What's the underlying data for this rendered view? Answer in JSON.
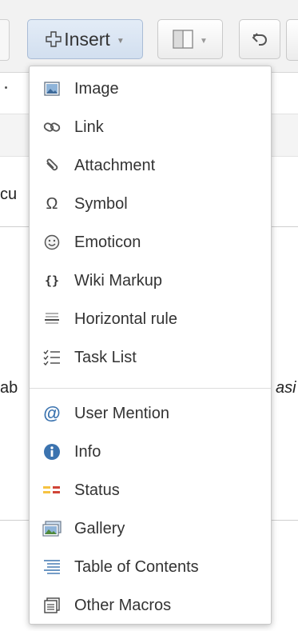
{
  "toolbar": {
    "insert_label": "Insert",
    "insert_icon": "plus-icon",
    "layout_icon": "page-layout-icon",
    "undo_icon": "undo-icon"
  },
  "background_text": {
    "fragment_1": "cu",
    "fragment_2": "ab",
    "fragment_3": "asi"
  },
  "menu": {
    "items": [
      {
        "label": "Image",
        "icon": "image-icon"
      },
      {
        "label": "Link",
        "icon": "link-icon"
      },
      {
        "label": "Attachment",
        "icon": "paperclip-icon"
      },
      {
        "label": "Symbol",
        "icon": "omega-icon"
      },
      {
        "label": "Emoticon",
        "icon": "smiley-icon"
      },
      {
        "label": "Wiki Markup",
        "icon": "braces-icon"
      },
      {
        "label": "Horizontal rule",
        "icon": "horizontal-rule-icon"
      },
      {
        "label": "Task List",
        "icon": "task-list-icon"
      },
      {
        "label": "User Mention",
        "icon": "at-icon"
      },
      {
        "label": "Info",
        "icon": "info-icon"
      },
      {
        "label": "Status",
        "icon": "status-icon"
      },
      {
        "label": "Gallery",
        "icon": "gallery-icon"
      },
      {
        "label": "Table of Contents",
        "icon": "table-of-contents-icon"
      },
      {
        "label": "Other Macros",
        "icon": "macros-icon"
      }
    ]
  },
  "colors": {
    "insert_button": "#d8e3f1",
    "at_sign": "#3b73af",
    "info_circle": "#3b73af",
    "status_yellow": "#f6c342",
    "status_red": "#d04437"
  }
}
